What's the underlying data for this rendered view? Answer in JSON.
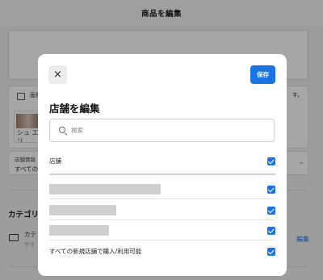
{
  "background": {
    "page_title": "商品を編集",
    "media_label": "画像",
    "media_suffix": "す。",
    "thumb_text": "シュ エ リ",
    "store_info_label": "店舗情報",
    "store_info_value": "すべての",
    "category_title": "カテゴリー",
    "category_name": "カテ",
    "category_sub": "サラ",
    "edit_link": "編集"
  },
  "modal": {
    "close_label": "×",
    "save_label": "保存",
    "title": "店舗を編集",
    "search": {
      "placeholder": "検索",
      "value": ""
    },
    "header_row": {
      "label": "店舗",
      "checked": true
    },
    "store_rows": [
      {
        "label": "",
        "redacted": true,
        "checked": true
      },
      {
        "label": "",
        "redacted": true,
        "checked": true
      },
      {
        "label": "",
        "redacted": true,
        "checked": true
      }
    ],
    "all_new_row": {
      "label": "すべての新規店舗で購入/利用可能",
      "checked": true
    }
  },
  "colors": {
    "accent": "#1a74e8",
    "redaction": "#cfcfcf",
    "overlay": "rgba(0,0,0,0.35)"
  }
}
